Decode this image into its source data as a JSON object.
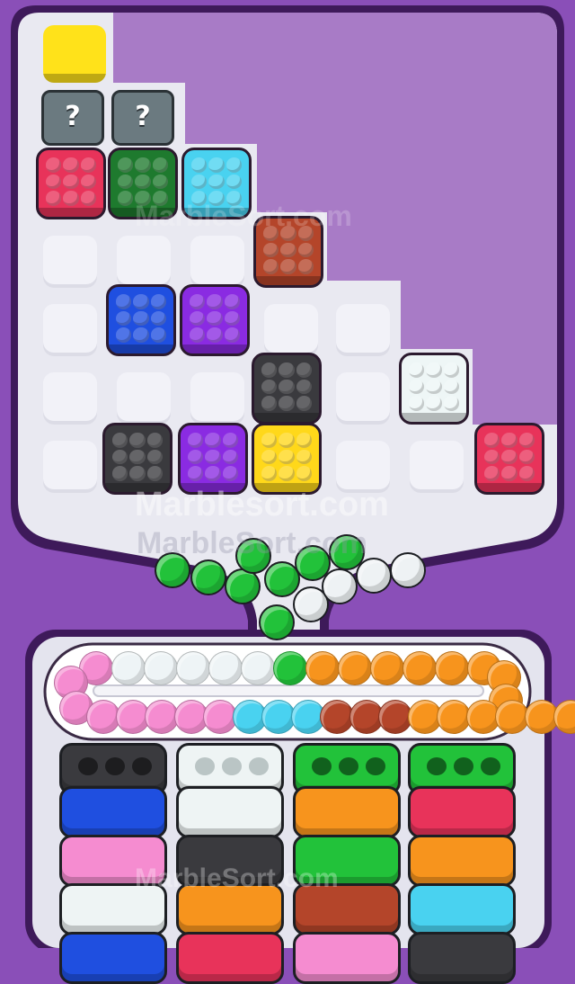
{
  "colors": {
    "frame": "#8a4fb8",
    "tray": "#e9e9f1",
    "upper_panel": "#a87bc6"
  },
  "watermarks": [
    "Marblesort.com",
    "MarbleSort.com",
    "MarbleSort.com",
    "MarbleSort.com"
  ],
  "mystery_label": "?",
  "grid_blocks": [
    {
      "color": "yellow",
      "hex": "#ffe21a",
      "plain": true
    },
    {
      "color": "mystery",
      "hex": "#6b7a80"
    },
    {
      "color": "mystery",
      "hex": "#6b7a80"
    },
    {
      "color": "red",
      "hex": "#e8335a"
    },
    {
      "color": "dark-green",
      "hex": "#1e7a2e"
    },
    {
      "color": "cyan",
      "hex": "#49d2f0"
    },
    {
      "color": "brown",
      "hex": "#b4452a"
    },
    {
      "color": "blue",
      "hex": "#1f4fe0"
    },
    {
      "color": "purple",
      "hex": "#8a2be2"
    },
    {
      "color": "charcoal",
      "hex": "#3a3a3e"
    },
    {
      "color": "white",
      "hex": "#eef6f6"
    },
    {
      "color": "charcoal",
      "hex": "#3a3a3e"
    },
    {
      "color": "purple",
      "hex": "#8a2be2"
    },
    {
      "color": "yellow",
      "hex": "#ffd81a"
    },
    {
      "color": "red",
      "hex": "#e8335a"
    }
  ],
  "loose_marbles": [
    {
      "color": "green",
      "hex": "#22c23a"
    },
    {
      "color": "green",
      "hex": "#22c23a"
    },
    {
      "color": "green",
      "hex": "#22c23a"
    },
    {
      "color": "green",
      "hex": "#22c23a"
    },
    {
      "color": "green",
      "hex": "#22c23a"
    },
    {
      "color": "green",
      "hex": "#22c23a"
    },
    {
      "color": "green",
      "hex": "#22c23a"
    },
    {
      "color": "green",
      "hex": "#22c23a"
    },
    {
      "color": "white",
      "hex": "#eef2f4"
    },
    {
      "color": "white",
      "hex": "#eef2f4"
    },
    {
      "color": "white",
      "hex": "#eef2f4"
    },
    {
      "color": "white",
      "hex": "#eef2f4"
    },
    {
      "color": "green",
      "hex": "#22c23a"
    }
  ],
  "conveyor_marbles": [
    "#f58cd0",
    "#eef4f6",
    "#eef4f6",
    "#eef4f6",
    "#eef4f6",
    "#eef4f6",
    "#22c23a",
    "#f7941d",
    "#f7941d",
    "#f7941d",
    "#f7941d",
    "#f7941d",
    "#f7941d",
    "#f58cd0",
    "#f58cd0",
    "#f58cd0",
    "#f58cd0",
    "#f58cd0",
    "#49d2f0",
    "#49d2f0",
    "#49d2f0",
    "#b4452a",
    "#b4452a",
    "#b4452a",
    "#f7941d",
    "#f7941d",
    "#f7941d",
    "#f7941d",
    "#f7941d",
    "#f7941d"
  ],
  "collection_boxes": [
    {
      "color": "charcoal",
      "hex": "#3a3a3e",
      "slots_filled": 0
    },
    {
      "color": "white",
      "hex": "#eef4f4",
      "slots_filled": 0
    },
    {
      "color": "green",
      "hex": "#22c23a",
      "slots_filled": 0
    },
    {
      "color": "green",
      "hex": "#22c23a",
      "slots_filled": 0
    },
    {
      "color": "blue",
      "hex": "#1f4fe0"
    },
    {
      "color": "white",
      "hex": "#eef4f4"
    },
    {
      "color": "orange",
      "hex": "#f7941d"
    },
    {
      "color": "red",
      "hex": "#e8335a"
    },
    {
      "color": "pink",
      "hex": "#f58cd0"
    },
    {
      "color": "charcoal",
      "hex": "#3a3a3e"
    },
    {
      "color": "green",
      "hex": "#22c23a"
    },
    {
      "color": "orange",
      "hex": "#f7941d"
    },
    {
      "color": "white",
      "hex": "#eef4f4"
    },
    {
      "color": "orange",
      "hex": "#f7941d"
    },
    {
      "color": "brown",
      "hex": "#b4452a"
    },
    {
      "color": "cyan",
      "hex": "#49d2f0"
    },
    {
      "color": "blue",
      "hex": "#1f4fe0"
    },
    {
      "color": "red",
      "hex": "#e8335a"
    },
    {
      "color": "pink",
      "hex": "#f58cd0"
    },
    {
      "color": "charcoal",
      "hex": "#3a3a3e"
    }
  ]
}
